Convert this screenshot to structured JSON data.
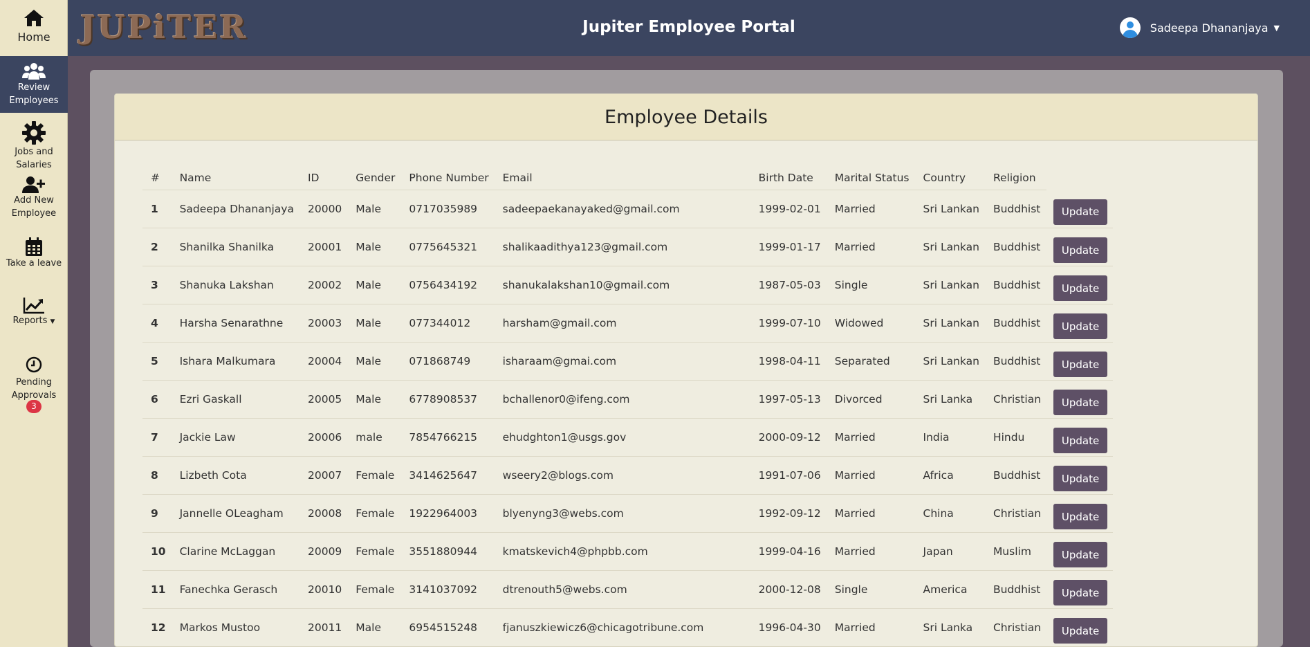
{
  "sidebar": {
    "home": "Home",
    "review_line1": "Review",
    "review_line2": "Employees",
    "jobs_line1": "Jobs and",
    "jobs_line2": "Salaries",
    "add_line1": "Add New",
    "add_line2": "Employee",
    "leave": "Take a leave",
    "reports": "Reports",
    "pending_line1": "Pending",
    "pending_line2": "Approvals",
    "pending_count": "3"
  },
  "header": {
    "logo": "JUPiTER",
    "title": "Jupiter Employee Portal",
    "user_name": "Sadeepa Dhananjaya"
  },
  "card": {
    "title": "Employee Details"
  },
  "table": {
    "columns": [
      "#",
      "Name",
      "ID",
      "Gender",
      "Phone Number",
      "Email",
      "Birth Date",
      "Marital Status",
      "Country",
      "Religion"
    ],
    "update_label": "Update",
    "rows": [
      [
        "1",
        "Sadeepa Dhananjaya",
        "20000",
        "Male",
        "0717035989",
        "sadeepaekanayaked@gmail.com",
        "1999-02-01",
        "Married",
        "Sri Lankan",
        "Buddhist"
      ],
      [
        "2",
        "Shanilka Shanilka",
        "20001",
        "Male",
        "0775645321",
        "shalikaadithya123@gmail.com",
        "1999-01-17",
        "Married",
        "Sri Lankan",
        "Buddhist"
      ],
      [
        "3",
        "Shanuka Lakshan",
        "20002",
        "Male",
        "0756434192",
        "shanukalakshan10@gmail.com",
        "1987-05-03",
        "Single",
        "Sri Lankan",
        "Buddhist"
      ],
      [
        "4",
        "Harsha Senarathne",
        "20003",
        "Male",
        "077344012",
        "harsham@gmail.com",
        "1999-07-10",
        "Widowed",
        "Sri Lankan",
        "Buddhist"
      ],
      [
        "5",
        "Ishara Malkumara",
        "20004",
        "Male",
        "071868749",
        "isharaam@gmai.com",
        "1998-04-11",
        "Separated",
        "Sri Lankan",
        "Buddhist"
      ],
      [
        "6",
        "Ezri Gaskall",
        "20005",
        "Male",
        "6778908537",
        "bchallenor0@ifeng.com",
        "1997-05-13",
        "Divorced",
        "Sri Lanka",
        "Christian"
      ],
      [
        "7",
        "Jackie Law",
        "20006",
        "male",
        "7854766215",
        "ehudghton1@usgs.gov",
        "2000-09-12",
        "Married",
        "India",
        "Hindu"
      ],
      [
        "8",
        "Lizbeth Cota",
        "20007",
        "Female",
        "3414625647",
        "wseery2@blogs.com",
        "1991-07-06",
        "Married",
        "Africa",
        "Buddhist"
      ],
      [
        "9",
        "Jannelle OLeagham",
        "20008",
        "Female",
        "1922964003",
        "blyenyng3@webs.com",
        "1992-09-12",
        "Married",
        "China",
        "Christian"
      ],
      [
        "10",
        "Clarine McLaggan",
        "20009",
        "Female",
        "3551880944",
        "kmatskevich4@phpbb.com",
        "1999-04-16",
        "Married",
        "Japan",
        "Muslim"
      ],
      [
        "11",
        "Fanechka Gerasch",
        "20010",
        "Female",
        "3141037092",
        "dtrenouth5@webs.com",
        "2000-12-08",
        "Single",
        "America",
        "Buddhist"
      ],
      [
        "12",
        "Markos Mustoo",
        "20011",
        "Male",
        "6954515248",
        "fjanuszkiewicz6@chicagotribune.com",
        "1996-04-30",
        "Married",
        "Sri Lanka",
        "Christian"
      ]
    ]
  }
}
